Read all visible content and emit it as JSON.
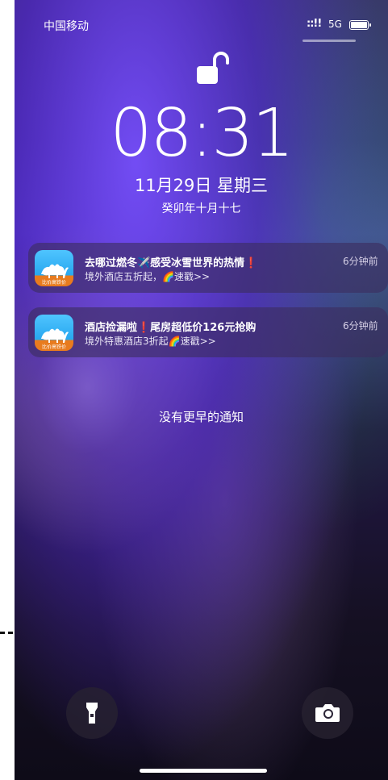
{
  "status_bar": {
    "carrier": "中国移动",
    "signal": "::!!",
    "network": "5G"
  },
  "lock_screen": {
    "time": "08:31",
    "date": "11月29日 星期三",
    "lunar_date": "癸卯年十月十七",
    "no_more_notifications": "没有更早的通知"
  },
  "notifications": [
    {
      "title": "去哪过燃冬✈️感受冰雪世界的热情❗",
      "body": "境外酒店五折起，🌈速戳>>",
      "time": "6分钟前"
    },
    {
      "title": "酒店捡漏啦❗尾房超低价126元抢购",
      "body": "境外特惠酒店3折起🌈速戳>>",
      "time": "6分钟前"
    }
  ],
  "app_icon_caption": "比价高铁价",
  "icons": {
    "lock": "unlocked-padlock-icon",
    "flashlight": "flashlight-icon",
    "camera": "camera-icon"
  },
  "colors": {
    "notification_bg": "#3c2d5f",
    "icon_sky": "#27a7ef",
    "icon_band": "#e87b1e"
  }
}
